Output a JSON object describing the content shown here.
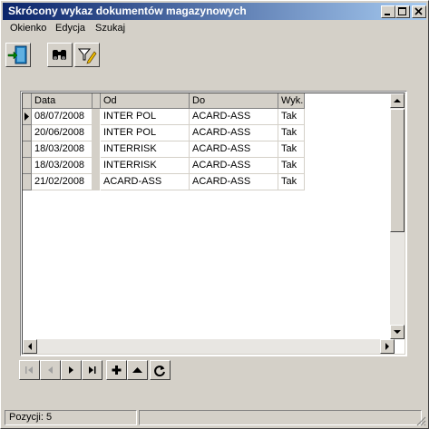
{
  "window": {
    "title": "Skrócony wykaz dokumentów magazynowych"
  },
  "menu": {
    "items": [
      "Okienko",
      "Edycja",
      "Szukaj"
    ]
  },
  "grid": {
    "columns": [
      "Data",
      "Od",
      "Do",
      "Wyk."
    ],
    "rows": [
      [
        "08/07/2008",
        "INTER POL",
        "ACARD-ASS",
        "Tak"
      ],
      [
        "20/06/2008",
        "INTER POL",
        "ACARD-ASS",
        "Tak"
      ],
      [
        "18/03/2008",
        "INTERRISK",
        "ACARD-ASS",
        "Tak"
      ],
      [
        "18/03/2008",
        "INTERRISK",
        "ACARD-ASS",
        "Tak"
      ],
      [
        "21/02/2008",
        "ACARD-ASS",
        "ACARD-ASS",
        "Tak"
      ]
    ]
  },
  "status": {
    "position": "Pozycji: 5"
  }
}
